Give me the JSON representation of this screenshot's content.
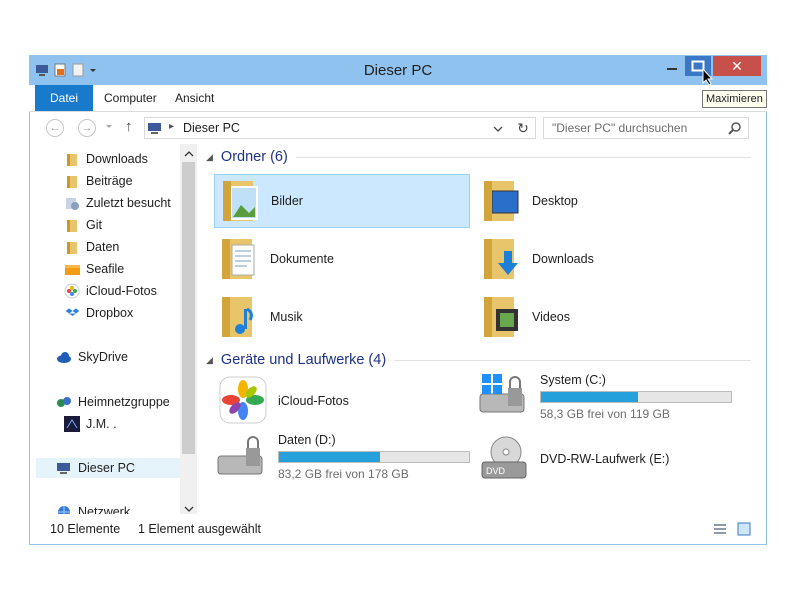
{
  "window": {
    "title": "Dieser PC",
    "close_symbol": "✕",
    "tooltip": "Maximieren"
  },
  "ribbon": {
    "tabs": [
      "Datei",
      "Computer",
      "Ansicht"
    ]
  },
  "address": {
    "path": "Dieser PC",
    "search_placeholder": "\"Dieser PC\" durchsuchen"
  },
  "nav": {
    "items": [
      {
        "label": "Downloads",
        "icon": "folder-download-icon"
      },
      {
        "label": "Beiträge",
        "icon": "folder-icon"
      },
      {
        "label": "Zuletzt besucht",
        "icon": "recent-places-icon"
      },
      {
        "label": "Git",
        "icon": "folder-icon"
      },
      {
        "label": "Daten",
        "icon": "folder-icon"
      },
      {
        "label": "Seafile",
        "icon": "seafile-folder-icon"
      },
      {
        "label": "iCloud-Fotos",
        "icon": "icloud-photos-icon"
      },
      {
        "label": "Dropbox",
        "icon": "dropbox-icon"
      },
      {
        "label": "SkyDrive",
        "icon": "skydrive-cloud-icon"
      },
      {
        "label": "Heimnetzgruppe",
        "icon": "homegroup-icon"
      },
      {
        "label": "J.M. .",
        "icon": "user-avatar-icon"
      },
      {
        "label": "Dieser PC",
        "icon": "computer-icon",
        "selected": true
      },
      {
        "label": "Netzwerk",
        "icon": "network-icon"
      }
    ]
  },
  "groups": {
    "folders_title": "Ordner (6)",
    "devices_title": "Geräte und Laufwerke (4)"
  },
  "folders": [
    {
      "label": "Bilder",
      "icon": "pictures-folder-icon",
      "selected": true
    },
    {
      "label": "Desktop",
      "icon": "desktop-folder-icon"
    },
    {
      "label": "Dokumente",
      "icon": "documents-folder-icon"
    },
    {
      "label": "Downloads",
      "icon": "downloads-folder-icon"
    },
    {
      "label": "Musik",
      "icon": "music-folder-icon"
    },
    {
      "label": "Videos",
      "icon": "videos-folder-icon"
    }
  ],
  "drives": [
    {
      "label": "iCloud-Fotos",
      "icon": "icloud-photos-icon"
    },
    {
      "label": "System (C:)",
      "free": "58,3 GB frei von 119 GB",
      "used_fraction": 0.51,
      "icon": "windows-drive-icon"
    },
    {
      "label": "Daten (D:)",
      "free": "83,2 GB frei von 178 GB",
      "used_fraction": 0.53,
      "icon": "hard-drive-icon"
    },
    {
      "label": "DVD-RW-Laufwerk (E:)",
      "icon": "dvd-drive-icon",
      "disc_label": "DVD"
    }
  ],
  "status": {
    "count": "10 Elemente",
    "selection": "1 Element ausgewählt"
  },
  "colors": {
    "accent": "#1979ca",
    "bar_fill": "#26a0da",
    "selection": "#cce8ff",
    "close": "#c7504a"
  }
}
